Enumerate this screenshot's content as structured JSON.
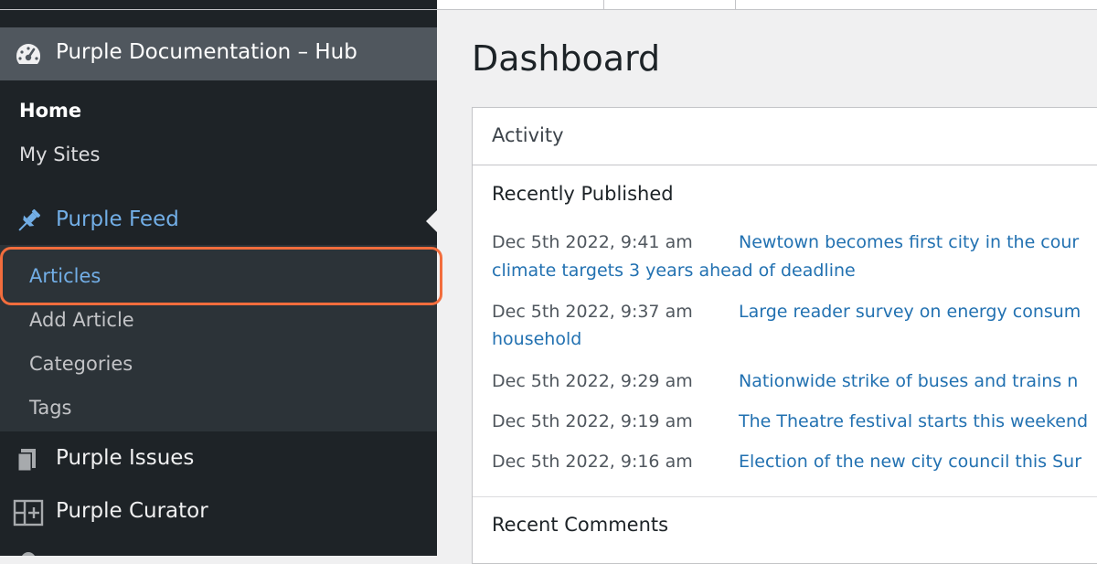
{
  "sidebar": {
    "site_title": "Purple Documentation – Hub",
    "home": "Home",
    "my_sites": "My Sites",
    "purple_feed": "Purple Feed",
    "submenu": {
      "articles": "Articles",
      "add_article": "Add Article",
      "categories": "Categories",
      "tags": "Tags"
    },
    "purple_issues": "Purple Issues",
    "purple_curator": "Purple Curator"
  },
  "main": {
    "page_title": "Dashboard",
    "activity": {
      "title": "Activity",
      "recently_published_title": "Recently Published",
      "items": [
        {
          "date": "Dec 5th 2022, 9:41 am",
          "title_line1": "Newtown becomes first city in the cour",
          "title_line2": "climate targets 3 years ahead of deadline"
        },
        {
          "date": "Dec 5th 2022, 9:37 am",
          "title_line1": "Large reader survey on energy consum",
          "title_line2": "household"
        },
        {
          "date": "Dec 5th 2022, 9:29 am",
          "title_line1": "Nationwide strike of buses and trains n"
        },
        {
          "date": "Dec 5th 2022, 9:19 am",
          "title_line1": "The Theatre festival starts this weekend"
        },
        {
          "date": "Dec 5th 2022, 9:16 am",
          "title_line1": "Election of the new city council this Sur"
        }
      ],
      "recent_comments_title": "Recent Comments"
    }
  },
  "colors": {
    "sidebar_bg": "#1e2327",
    "submenu_bg": "#2c3338",
    "accent_link": "#2271b1",
    "menu_active": "#72aee6",
    "highlight": "#f26d3d"
  }
}
